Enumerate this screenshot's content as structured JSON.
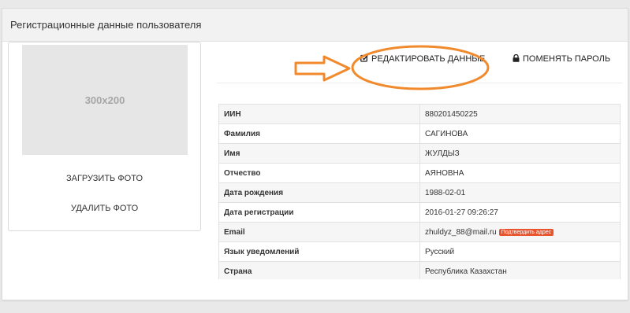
{
  "panel": {
    "title": "Регистрационные данные пользователя"
  },
  "photo": {
    "placeholder": "300x200",
    "upload_label": "ЗАГРУЗИТЬ ФОТО",
    "delete_label": "УДАЛИТЬ ФОТО"
  },
  "actions": {
    "edit_label": "РЕДАКТИРОВАТЬ ДАННЫЕ",
    "edit_icon": "edit-icon",
    "password_label": "ПОМЕНЯТЬ ПАРОЛЬ",
    "password_icon": "lock-icon"
  },
  "annotation": {
    "color": "#f08a2c"
  },
  "info": {
    "rows": [
      {
        "key": "ИИН",
        "value": "880201450225"
      },
      {
        "key": "Фамилия",
        "value": "САГИНОВА"
      },
      {
        "key": "Имя",
        "value": "ЖУЛДЫЗ"
      },
      {
        "key": "Отчество",
        "value": "АЯНОВНА"
      },
      {
        "key": "Дата рождения",
        "value": "1988-02-01"
      },
      {
        "key": "Дата регистрации",
        "value": "2016-01-27 09:26:27"
      },
      {
        "key": "Email",
        "value": "zhuldyz_88@mail.ru",
        "badge": "Подтвердить адрес"
      },
      {
        "key": "Язык уведомлений",
        "value": "Русский"
      },
      {
        "key": "Страна",
        "value": "Республика Казахстан"
      }
    ]
  },
  "colors": {
    "badge": "#e9542e",
    "placeholder_bg": "#e6e6e6"
  }
}
